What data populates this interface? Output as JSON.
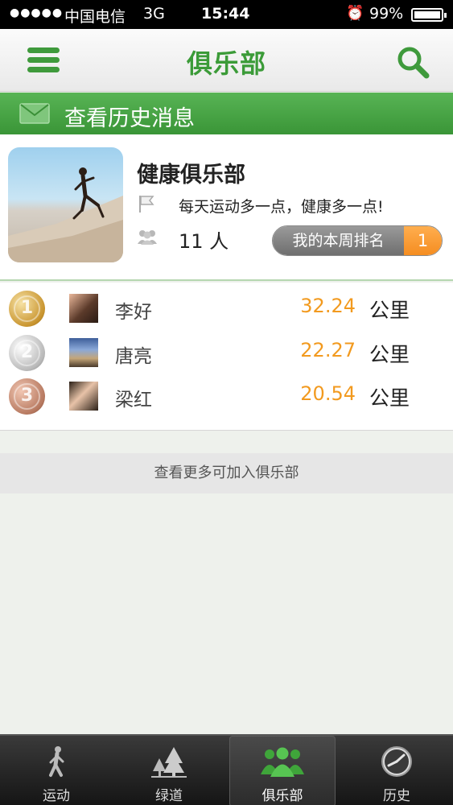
{
  "status_bar": {
    "signal": "●●●●●",
    "carrier": "中国电信",
    "network": "3G",
    "time": "15:44",
    "battery": "99%"
  },
  "nav": {
    "title": "俱乐部",
    "menu_icon": "menu-icon",
    "search_icon": "search-icon"
  },
  "history": {
    "label": "查看历史消息",
    "icon": "mail-icon"
  },
  "club": {
    "name": "健康俱乐部",
    "motto": "每天运动多一点，健康多一点!",
    "member_count": "11 人",
    "rank_label": "我的本周排名",
    "rank_value": "1"
  },
  "leaderboard": [
    {
      "medal": "gold",
      "name": "李好",
      "distance": "32.24",
      "unit": "公里"
    },
    {
      "medal": "silver",
      "name": "唐亮",
      "distance": "22.27",
      "unit": "公里"
    },
    {
      "medal": "bronze",
      "name": "梁红",
      "distance": "20.54",
      "unit": "公里"
    }
  ],
  "more_clubs_label": "查看更多可加入俱乐部",
  "tabs": [
    {
      "label": "运动",
      "icon": "walking-person-icon",
      "active": false
    },
    {
      "label": "绿道",
      "icon": "trees-icon",
      "active": false
    },
    {
      "label": "俱乐部",
      "icon": "group-icon",
      "active": true
    },
    {
      "label": "历史",
      "icon": "history-clock-icon",
      "active": false
    }
  ],
  "colors": {
    "accent_green": "#3b9b38",
    "distance_orange": "#f29a1f",
    "rank_orange": "#f48b1e"
  }
}
